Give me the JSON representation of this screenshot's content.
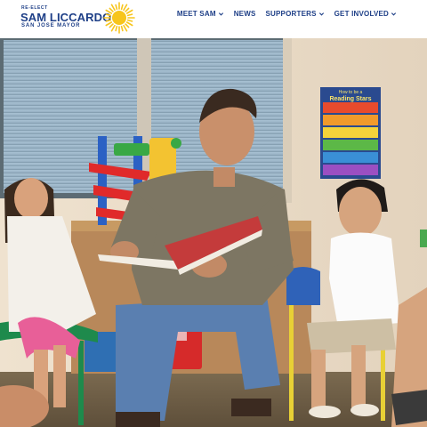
{
  "logo": {
    "pre": "RE-ELECT",
    "name": "SAM LICCARDO",
    "sub": "SAN JOSE MAYOR"
  },
  "nav": [
    {
      "label": "MEET SAM",
      "has_dropdown": true
    },
    {
      "label": "NEWS",
      "has_dropdown": false
    },
    {
      "label": "SUPPORTERS",
      "has_dropdown": true
    },
    {
      "label": "GET INVOLVED",
      "has_dropdown": true
    }
  ],
  "poster": {
    "title_line1": "How to be a",
    "title_line2": "Reading Stars"
  },
  "colors": {
    "brand_blue": "#1e3f87",
    "sun_yellow": "#f7c51c"
  },
  "icons": [
    "sun-logo-icon",
    "chevron-down-icon"
  ]
}
